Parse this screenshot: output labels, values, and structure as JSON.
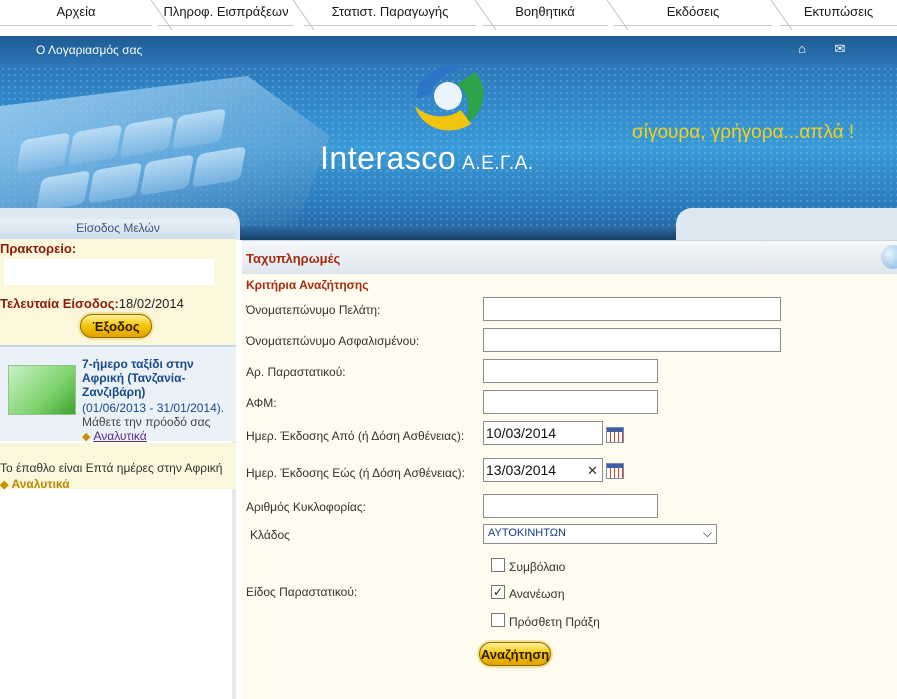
{
  "nav": {
    "items": [
      "Αρχεία",
      "Πληροφ. Εισπράξεων",
      "Στατιστ. Παραγωγής",
      "Βοηθητικά",
      "Εκδόσεις",
      "Εκτυπώσεις"
    ]
  },
  "header": {
    "account_link": "Ο Λογαριασμός σας",
    "home_icon": "home-icon",
    "mail_icon": "mail-icon",
    "brand": "Interasco",
    "brand_suffix": "Α.Ε.Γ.Α.",
    "slogan": "σίγουρα, γρήγορα...απλά !"
  },
  "sidebar": {
    "title": "Είσοδος Μελών",
    "agency_label": "Πρακτορείο:",
    "last_login_label": "Τελευταία Είσοδος:",
    "last_login_value": "18/02/2014",
    "exit_label": "Έξοδος",
    "promo": {
      "title": "7-ήμερο ταξίδι στην Αφρική (Τανζανία-Ζανζιβάρη)",
      "dates": "(01/06/2013 - 31/01/2014).",
      "learn": "Μάθετε την πρόοδό σας",
      "more": "Αναλυτικά"
    },
    "bottom_text": "Το έπαθλο είναι Επτά ημέρες στην Αφρική",
    "bottom_more": "Αναλυτικά"
  },
  "main": {
    "title": "Ταχυπληρωμές",
    "criteria": "Κριτήρια Αναζήτησης",
    "fields": {
      "client_name": {
        "label": "Όνοματεπώνυμο Πελάτη:",
        "value": ""
      },
      "insured_name": {
        "label": "Όνοματεπώνυμο Ασφαλισμένου:",
        "value": ""
      },
      "doc_no": {
        "label": "Αρ. Παραστατικού:",
        "value": ""
      },
      "afm": {
        "label": "ΑΦΜ:",
        "value": ""
      },
      "date_from": {
        "label": "Ημερ. Έκδοσης Από (ή Δόση Ασθένειας):",
        "value": "10/03/2014"
      },
      "date_to": {
        "label": "Ημερ. Έκδοσης Εώς (ή Δόση Ασθένειας):",
        "value": "13/03/2014"
      },
      "plate": {
        "label": "Αριθμός Κυκλοφορίας:",
        "value": ""
      },
      "branch": {
        "label": "Κλάδος",
        "value": "ΑΥΤΟΚΙΝΗΤΩΝ"
      }
    },
    "doc_type": {
      "label": "Είδος Παραστατικού:",
      "options": [
        {
          "label": "Συμβόλαιο",
          "checked": false
        },
        {
          "label": "Ανανέωση",
          "checked": true
        },
        {
          "label": "Πρόσθετη Πράξη",
          "checked": false
        }
      ]
    },
    "search_label": "Αναζήτηση"
  }
}
